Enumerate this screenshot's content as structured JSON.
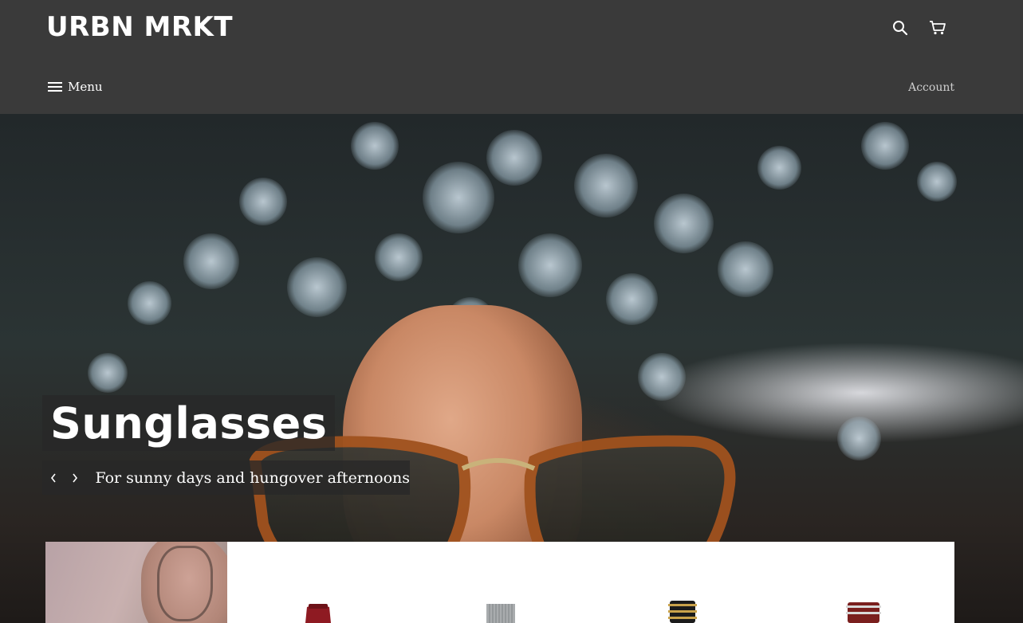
{
  "header": {
    "logo": "URBN MRKT",
    "menu_label": "Menu",
    "account_label": "Account",
    "icons": [
      "search-icon",
      "cart-icon",
      "hamburger-icon"
    ]
  },
  "hero": {
    "title": "Sunglasses",
    "subtitle": "For sunny days and hungover afternoons",
    "controls": [
      "chevron-left-icon",
      "chevron-right-icon"
    ]
  },
  "featured": {
    "products": [
      "red-watch",
      "silver-mesh-watch",
      "black-gold-watch",
      "red-leather-watch"
    ]
  },
  "colors": {
    "header_bg": "#3a3a3a",
    "text_light": "#ffffff",
    "account_text": "#cfcfcf",
    "overlay": "rgba(40,40,40,0.78)"
  }
}
